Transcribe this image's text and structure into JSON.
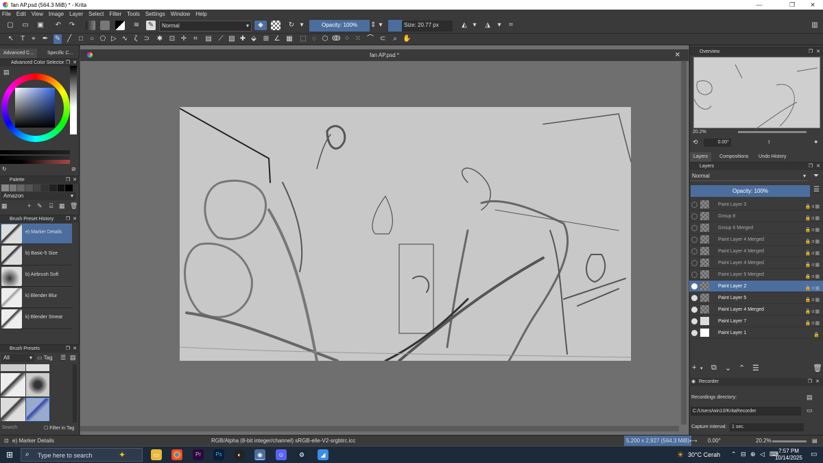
{
  "window": {
    "title": "fan AP.psd (564.3 MiB)  * - Krita",
    "min": "—",
    "max": "❐",
    "close": "✕"
  },
  "menu": [
    "File",
    "Edit",
    "View",
    "Image",
    "Layer",
    "Select",
    "Filter",
    "Tools",
    "Settings",
    "Window",
    "Help"
  ],
  "toolbar": {
    "blend_mode": "Normal",
    "opacity": "Opacity: 100%",
    "size": "Size: 20.77 px"
  },
  "left_dock": {
    "tabs": [
      "Advanced C...",
      "Specific C..."
    ],
    "color_selector_title": "Advanced Color Selector",
    "palette_title": "Palette",
    "palette_name": "Amazon",
    "brush_history_title": "Brush Preset History",
    "brush_history": [
      "e) Marker Details",
      "b) Basic-5 Size",
      "b) Airbrush Soft",
      "k) Blender Blur",
      "k) Blender Smear"
    ],
    "brush_presets_title": "Brush Presets",
    "presets_filter": "All",
    "presets_tag": "Tag",
    "search_placeholder": "Search",
    "filter_in_tag": "Filter in Tag"
  },
  "document": {
    "tab_title": "fan AP.psd *"
  },
  "right_dock": {
    "overview_title": "Overview",
    "zoom": "20.2%",
    "rotation": "0.00°",
    "tabs": [
      "Layers",
      "Compositions",
      "Undo History"
    ],
    "layers_title": "Layers",
    "blend_mode": "Normal",
    "opacity": "Opacity:  100%",
    "layers": [
      {
        "name": "Paint Layer 3",
        "visible": false,
        "active": false
      },
      {
        "name": "Group 8",
        "visible": false,
        "active": false
      },
      {
        "name": "Group 6 Merged",
        "visible": false,
        "active": false
      },
      {
        "name": "Paint Layer 4 Merged",
        "visible": false,
        "active": false
      },
      {
        "name": "Paint Layer 4 Merged",
        "visible": false,
        "active": false
      },
      {
        "name": "Paint Layer 4 Merged",
        "visible": false,
        "active": false
      },
      {
        "name": "Paint Layer 5 Merged",
        "visible": false,
        "active": false
      },
      {
        "name": "Paint Layer 2",
        "visible": true,
        "active": true
      },
      {
        "name": "Paint Layer 5",
        "visible": true,
        "active": false
      },
      {
        "name": "Paint Layer 4 Merged",
        "visible": true,
        "active": false
      },
      {
        "name": "Paint Layer 7",
        "visible": true,
        "active": false
      },
      {
        "name": "Paint Layer 1",
        "visible": true,
        "active": false
      }
    ],
    "recorder_title": "Recorder",
    "recordings_dir_label": "Recordings directory:",
    "recordings_dir": "C:/Users/win10/KritaRecorder",
    "capture_label": "Capture interval:",
    "capture_value": "1 sec."
  },
  "status": {
    "brush": "e) Marker Details",
    "color_profile": "RGB/Alpha (8-bit integer/channel)  sRGB-elle-V2-srgbtrc.icc",
    "dimensions": "5,200 x 2,927 (564.3 MiB)",
    "rotation": "0.00°",
    "zoom": "20.2%"
  },
  "taskbar": {
    "search_placeholder": "Type here to search",
    "weather": "30°C  Cerah",
    "time": "7:57 PM",
    "date": "10/14/2025"
  },
  "colors": {
    "accent": "#4c6e9e",
    "panel": "#3b3b3b",
    "canvas_bg": "#6f6f6f",
    "paper": "#c8c8c8"
  }
}
